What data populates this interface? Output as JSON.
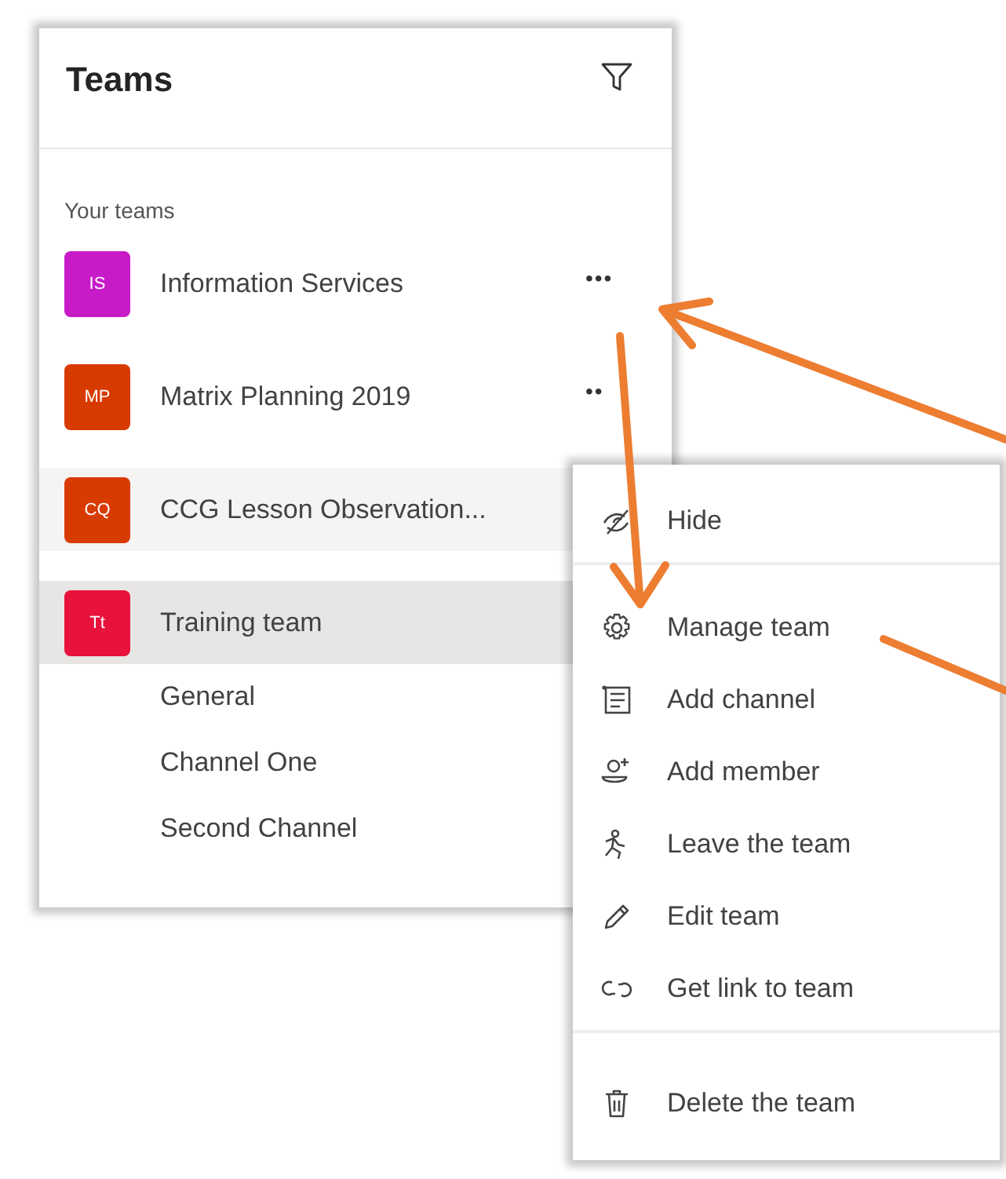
{
  "panel": {
    "title": "Teams",
    "section_label": "Your teams",
    "teams": [
      {
        "initials": "IS",
        "name": "Information Services",
        "color": "#c81bc8",
        "selected": false,
        "hovered": false,
        "more": "•••"
      },
      {
        "initials": "MP",
        "name": "Matrix Planning 2019",
        "color": "#d83b01",
        "selected": false,
        "hovered": false,
        "more": "••"
      },
      {
        "initials": "CQ",
        "name": "CCG Lesson Observation...",
        "color": "#d83b01",
        "selected": false,
        "hovered": true
      },
      {
        "initials": "Tt",
        "name": "Training team",
        "color": "#e8123c",
        "selected": true,
        "hovered": false,
        "channels": [
          {
            "name": "General"
          },
          {
            "name": "Channel One"
          },
          {
            "name": "Second Channel"
          }
        ]
      }
    ]
  },
  "menu": {
    "sections": [
      {
        "items": [
          {
            "label": "Hide"
          }
        ]
      },
      {
        "items": [
          {
            "label": "Manage team"
          },
          {
            "label": "Add channel"
          },
          {
            "label": "Add member"
          },
          {
            "label": "Leave the team"
          },
          {
            "label": "Edit team"
          },
          {
            "label": "Get link to team"
          }
        ]
      },
      {
        "items": [
          {
            "label": "Delete the team"
          }
        ]
      }
    ]
  }
}
